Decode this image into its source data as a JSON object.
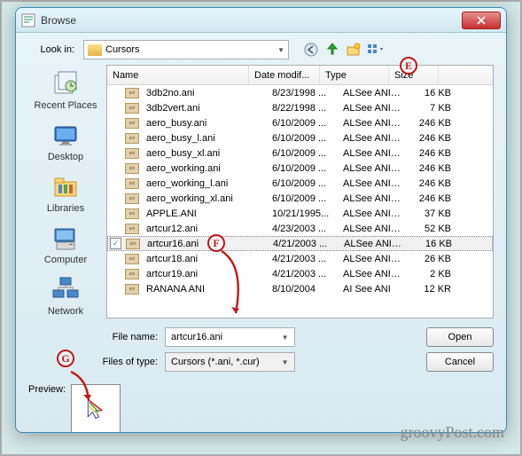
{
  "title": "Browse",
  "lookin_label": "Look in:",
  "lookin_value": "Cursors",
  "columns": {
    "name": "Name",
    "date": "Date modif...",
    "type": "Type",
    "size": "Size"
  },
  "places": [
    {
      "key": "recent",
      "label": "Recent Places"
    },
    {
      "key": "desktop",
      "label": "Desktop"
    },
    {
      "key": "libraries",
      "label": "Libraries"
    },
    {
      "key": "computer",
      "label": "Computer"
    },
    {
      "key": "network",
      "label": "Network"
    }
  ],
  "files": [
    {
      "name": "3db2no.ani",
      "date": "8/23/1998 ...",
      "type": "ALSee ANI ...",
      "size": "16 KB"
    },
    {
      "name": "3db2vert.ani",
      "date": "8/22/1998 ...",
      "type": "ALSee ANI ...",
      "size": "7 KB"
    },
    {
      "name": "aero_busy.ani",
      "date": "6/10/2009 ...",
      "type": "ALSee ANI ...",
      "size": "246 KB"
    },
    {
      "name": "aero_busy_l.ani",
      "date": "6/10/2009 ...",
      "type": "ALSee ANI ...",
      "size": "246 KB"
    },
    {
      "name": "aero_busy_xl.ani",
      "date": "6/10/2009 ...",
      "type": "ALSee ANI ...",
      "size": "246 KB"
    },
    {
      "name": "aero_working.ani",
      "date": "6/10/2009 ...",
      "type": "ALSee ANI ...",
      "size": "246 KB"
    },
    {
      "name": "aero_working_l.ani",
      "date": "6/10/2009 ...",
      "type": "ALSee ANI ...",
      "size": "246 KB"
    },
    {
      "name": "aero_working_xl.ani",
      "date": "6/10/2009 ...",
      "type": "ALSee ANI ...",
      "size": "246 KB"
    },
    {
      "name": "APPLE.ANI",
      "date": "10/21/1995...",
      "type": "ALSee ANI ...",
      "size": "37 KB"
    },
    {
      "name": "artcur12.ani",
      "date": "4/23/2003 ...",
      "type": "ALSee ANI ...",
      "size": "52 KB"
    },
    {
      "name": "artcur16.ani",
      "date": "4/21/2003 ...",
      "type": "ALSee ANI ...",
      "size": "16 KB",
      "selected": true
    },
    {
      "name": "artcur18.ani",
      "date": "4/21/2003 ...",
      "type": "ALSee ANI ...",
      "size": "26 KB"
    },
    {
      "name": "artcur19.ani",
      "date": "4/21/2003 ...",
      "type": "ALSee ANI ...",
      "size": "2 KB"
    },
    {
      "name": "RANANA ANI",
      "date": "8/10/2004",
      "type": "AI See ANI",
      "size": "12 KR"
    }
  ],
  "filename_label": "File name:",
  "filename_value": "artcur16.ani",
  "filetype_label": "Files of type:",
  "filetype_value": "Cursors (*.ani, *.cur)",
  "open_btn": "Open",
  "cancel_btn": "Cancel",
  "preview_label": "Preview:",
  "badges": {
    "e": "E",
    "f": "F",
    "g": "G"
  },
  "brand": "groovyPost.com",
  "toolbar_icons": [
    "back-icon",
    "up-icon",
    "new-folder-icon",
    "view-menu-icon"
  ]
}
